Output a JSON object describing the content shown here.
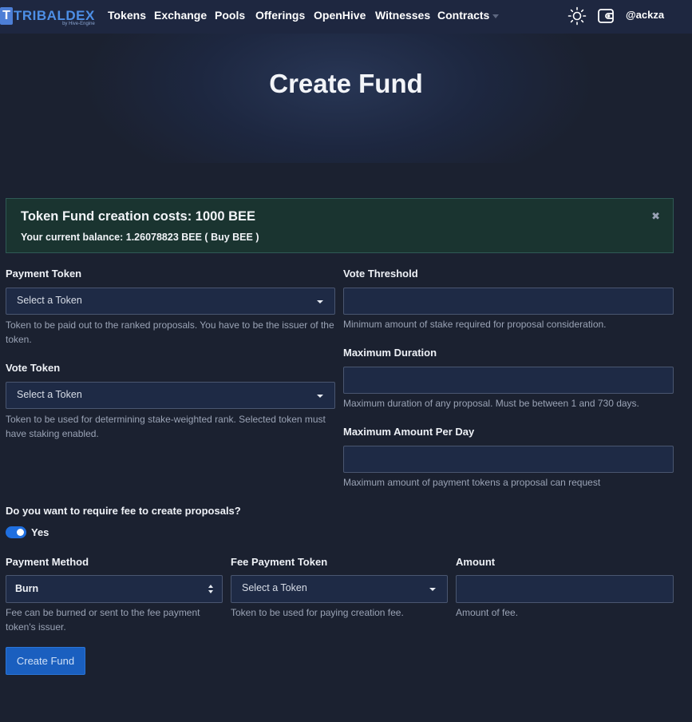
{
  "nav": {
    "logo_text": "TRIBALDEX",
    "logo_badge": "T",
    "logo_sub": "by Hive-Engine",
    "links": [
      "Tokens",
      "Exchange",
      "Pools",
      "Offerings",
      "OpenHive",
      "Witnesses",
      "Contracts"
    ],
    "user": "@ackza",
    "icons": [
      "sun-icon",
      "wallet-icon"
    ]
  },
  "page": {
    "title": "Create Fund"
  },
  "alert": {
    "title": "Token Fund creation costs: 1000 BEE",
    "balance": "Your current balance: 1.26078823 BEE ( Buy BEE )",
    "close": "✖"
  },
  "form": {
    "payment_token": {
      "label": "Payment Token",
      "placeholder": "Select a Token",
      "help": "Token to be paid out to the ranked proposals. You have to be the issuer of the token."
    },
    "vote_token": {
      "label": "Vote Token",
      "placeholder": "Select a Token",
      "help": "Token to be used for determining stake-weighted rank. Selected token must have staking enabled."
    },
    "vote_threshold": {
      "label": "Vote Threshold",
      "value": "",
      "help": "Minimum amount of stake required for proposal consideration."
    },
    "max_duration": {
      "label": "Maximum Duration",
      "value": "",
      "help": "Maximum duration of any proposal. Must be between 1 and 730 days."
    },
    "max_amount": {
      "label": "Maximum Amount Per Day",
      "value": "",
      "help": "Maximum amount of payment tokens a proposal can request"
    },
    "fee_question": "Do you want to require fee to create proposals?",
    "fee_toggle_label": "Yes",
    "payment_method": {
      "label": "Payment Method",
      "value": "Burn",
      "help": "Fee can be burned or sent to the fee payment token's issuer."
    },
    "fee_payment_token": {
      "label": "Fee Payment Token",
      "placeholder": "Select a Token",
      "help": "Token to be used for paying creation fee."
    },
    "amount": {
      "label": "Amount",
      "value": "",
      "help": "Amount of fee."
    },
    "submit": "Create Fund"
  }
}
